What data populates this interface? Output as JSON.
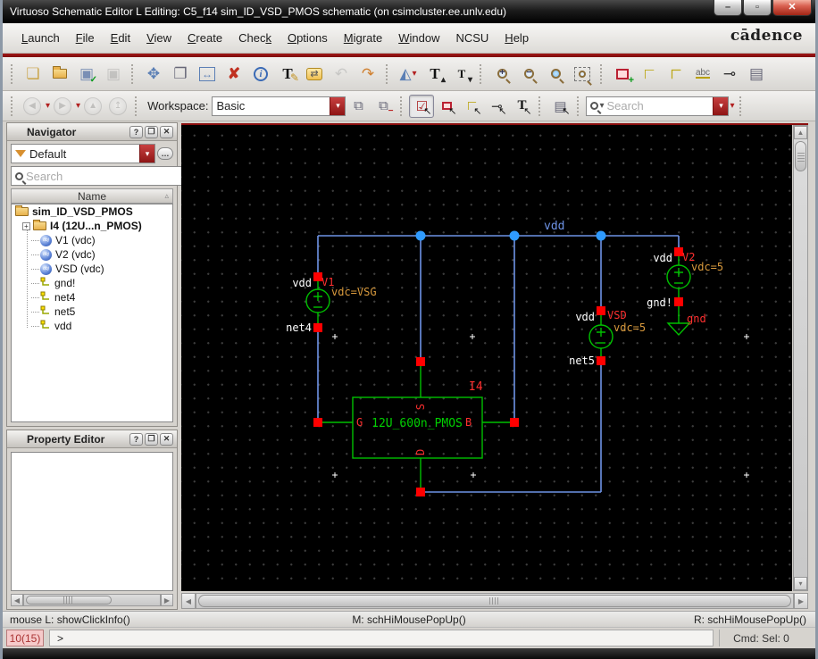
{
  "window": {
    "title": "Virtuoso Schematic Editor L Editing: C5_f14 sim_ID_VSD_PMOS schematic (on csimcluster.ee.unlv.edu)",
    "minimize": "–",
    "maximize": "▫",
    "close": "✕"
  },
  "brand": "cādence",
  "menu": {
    "items": [
      {
        "label": "Launch",
        "u": 0
      },
      {
        "label": "File",
        "u": 0
      },
      {
        "label": "Edit",
        "u": 0
      },
      {
        "label": "View",
        "u": 0
      },
      {
        "label": "Create",
        "u": 0
      },
      {
        "label": "Check",
        "u": 4
      },
      {
        "label": "Options",
        "u": 0
      },
      {
        "label": "Migrate",
        "u": 0
      },
      {
        "label": "Window",
        "u": 0
      },
      {
        "label": "NCSU",
        "u": -1
      },
      {
        "label": "Help",
        "u": 0
      }
    ]
  },
  "icons": {
    "new_file": "❏",
    "check_save": "▣",
    "save": "▣",
    "check": "✓",
    "move": "✥",
    "copy": "❐",
    "stretch": "↔",
    "delete": "✘",
    "info": "i",
    "edit_label_T": "T",
    "pencil": "✎",
    "descend": "⇄",
    "undo": "↶",
    "redo": "↷",
    "mirror": "◭",
    "T": "T",
    "caret": "▾",
    "caret_up": "▴",
    "zoom_plus": "+",
    "zoom_minus": "−",
    "wire": "∟",
    "wire_label": "abc",
    "pin": "⊸",
    "property_form": "▤",
    "back": "◀",
    "forward": "▶",
    "up": "▲",
    "top": "↥",
    "panels": "⧉",
    "mode_select": "☑",
    "pointer": "↖",
    "expander": "+",
    "obj_label": "obj",
    "sort_asc": "▵",
    "help": "?",
    "float": "❐",
    "close": "✕",
    "ellipsis": "…",
    "grip_bars": "⁞"
  },
  "toolbar2": {
    "workspace_label": "Workspace:",
    "workspace_value": "Basic",
    "search_placeholder": "Search"
  },
  "navigator": {
    "title": "Navigator",
    "filter_value": "Default",
    "search_placeholder": "Search",
    "column_header": "Name"
  },
  "tree": {
    "items": [
      {
        "label": "sim_ID_VSD_PMOS",
        "icon": "folder",
        "bold": true,
        "level": 0,
        "expander": false
      },
      {
        "label": "I4 (12U...n_PMOS)",
        "icon": "folder",
        "bold": true,
        "level": 1,
        "expander": true
      },
      {
        "label": "V1 (vdc)",
        "icon": "obj",
        "bold": false,
        "level": 2,
        "expander": false
      },
      {
        "label": "V2 (vdc)",
        "icon": "obj",
        "bold": false,
        "level": 2,
        "expander": false
      },
      {
        "label": "VSD (vdc)",
        "icon": "obj",
        "bold": false,
        "level": 2,
        "expander": false
      },
      {
        "label": "gnd!",
        "icon": "net",
        "bold": false,
        "level": 2,
        "expander": false
      },
      {
        "label": "net4",
        "icon": "net",
        "bold": false,
        "level": 2,
        "expander": false
      },
      {
        "label": "net5",
        "icon": "net",
        "bold": false,
        "level": 2,
        "expander": false
      },
      {
        "label": "vdd",
        "icon": "net",
        "bold": false,
        "level": 2,
        "expander": false
      }
    ]
  },
  "property_editor": {
    "title": "Property Editor"
  },
  "schematic": {
    "rail_label": "vdd",
    "v1": {
      "name": "V1",
      "top_net": "vdd",
      "bottom_net": "net4",
      "value": "vdc=VSG"
    },
    "vsd": {
      "name": "VSD",
      "top_net": "vdd",
      "bottom_net": "net5",
      "value": "vdc=5"
    },
    "v2": {
      "name": "V2",
      "top_net": "vdd",
      "bottom_net": "gnd!",
      "value": "vdc=5"
    },
    "gnd": {
      "name": "gnd"
    },
    "inst": {
      "name": "I4",
      "cell": "12U_600n_PMOS",
      "pin_g": "G",
      "pin_s": "S",
      "pin_d": "D",
      "pin_b": "B"
    },
    "colors": {
      "wire": "#6e93e6",
      "junction": "#2f9bff",
      "device": "#00c000",
      "pin": "#ff0000",
      "net_label": "#ffffff",
      "instance_label": "#ff3030",
      "value_label": "#d99a3d",
      "background": "#000000"
    }
  },
  "statusbar": {
    "left": "mouse L: showClickInfo()",
    "middle": "M: schHiMousePopUp()",
    "right": "R: schHiMousePopUp()"
  },
  "command": {
    "history_count": "10(15)",
    "prompt": ">",
    "cmd_sel": "Cmd: Sel: 0"
  }
}
